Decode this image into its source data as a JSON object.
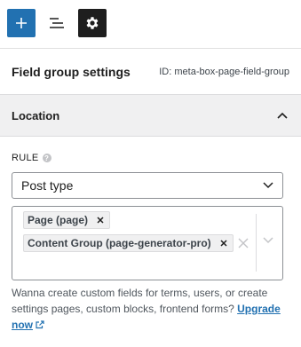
{
  "toolbar": {
    "buttons": [
      "add",
      "list-view",
      "settings"
    ]
  },
  "settings": {
    "title": "Field group settings",
    "id_text": "ID: meta-box-page-field-group"
  },
  "location": {
    "title": "Location"
  },
  "rule": {
    "label": "RULE",
    "help": "?",
    "select_value": "Post type"
  },
  "values": {
    "tags": [
      {
        "label": "Page (page)"
      },
      {
        "label": "Content Group (page-generator-pro)"
      }
    ]
  },
  "help": {
    "text": "Wanna create custom fields for terms, users, or create settings pages, custom blocks, frontend forms?",
    "link_label": "Upgrade now"
  },
  "colors": {
    "accent": "#2271b1",
    "dark": "#1e1e1e",
    "panel_bg": "#f0f0f1"
  }
}
